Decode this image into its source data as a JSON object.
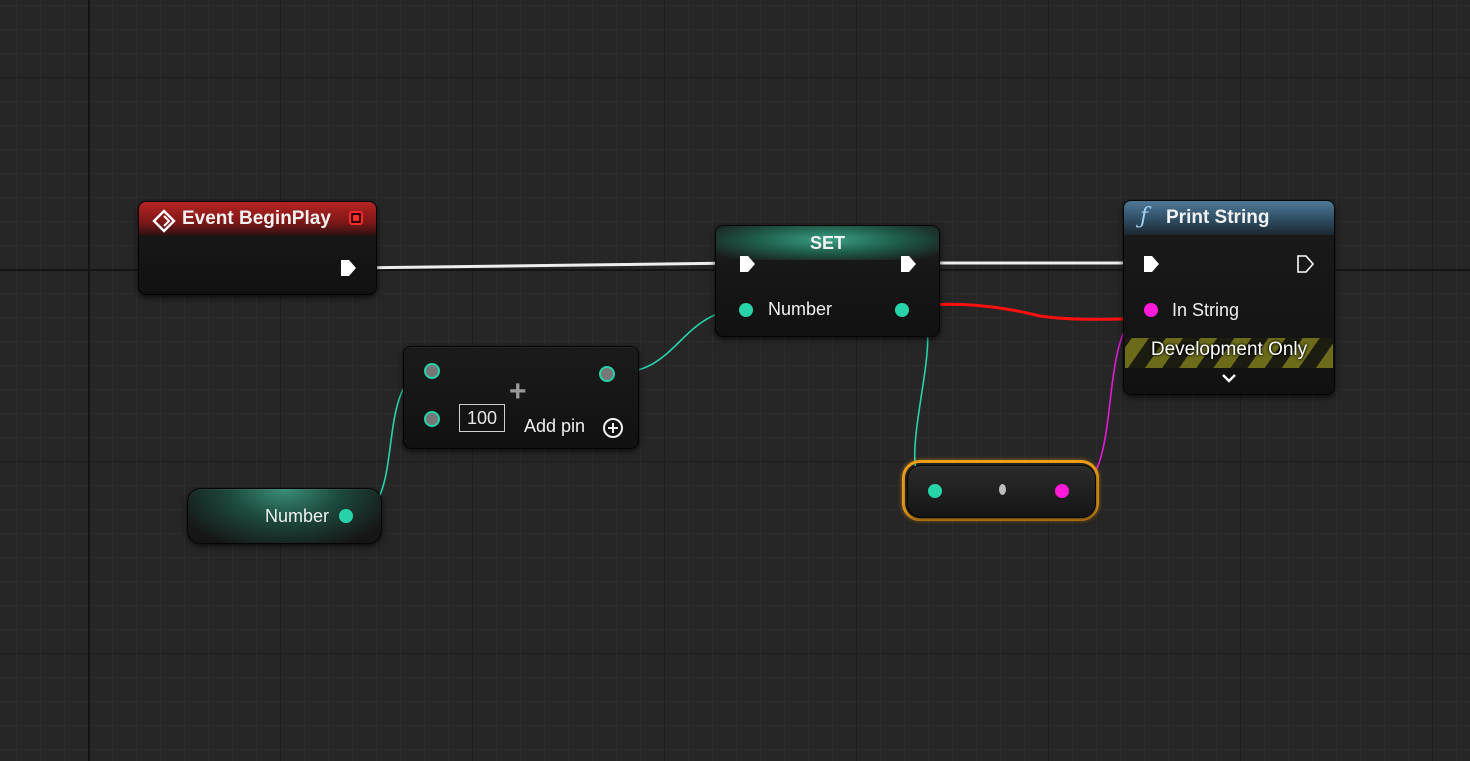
{
  "colors": {
    "event_header": "#a51f1f",
    "function_header": "#3a607c",
    "set_header": "#1d6b55",
    "float_pin": "#27d3a8",
    "string_pin": "#ff19d8",
    "exec_pin": "#ffffff",
    "wire_exec": "#eeeeee",
    "wire_float": "#27d3a8",
    "wire_string": "#e21ad6",
    "annotation_red": "#ff1010",
    "selection_orange": "#f2a01a",
    "dev_stripe": "#6b6b1a"
  },
  "event_node": {
    "title": "Event BeginPlay",
    "icon": "event-diamond-icon",
    "delegate_icon": "delegate-square-icon"
  },
  "set_node": {
    "title": "SET",
    "pin_label": "Number"
  },
  "add_node": {
    "operator": "+",
    "input_b_value": "100",
    "add_pin_label": "Add pin",
    "add_pin_icon": "plus-circle-icon"
  },
  "get_node": {
    "label": "Number"
  },
  "print_node": {
    "title": "Print String",
    "icon": "function-f-icon",
    "title_icon_glyph": "ƒ",
    "pin_label": "In String",
    "dev_label": "Development Only",
    "expand_icon": "chevron-down-icon"
  },
  "conversion_node": {
    "icon": "conversion-dot-icon"
  }
}
